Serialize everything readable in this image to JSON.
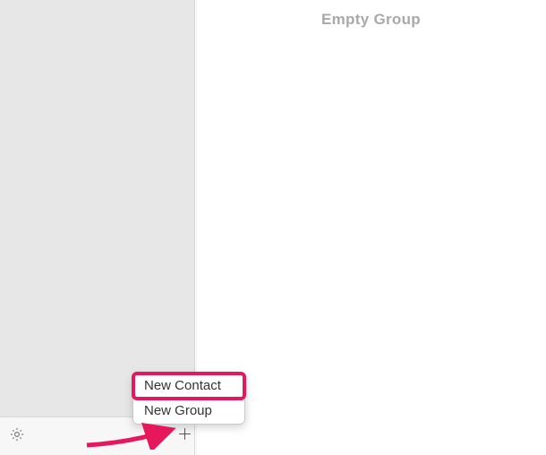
{
  "main": {
    "title": "Empty Group"
  },
  "popup": {
    "new_contact": "New Contact",
    "new_group": "New Group"
  },
  "icons": {
    "gear": "settings-gear",
    "plus": "plus"
  },
  "annotation": {
    "highlight_color": "#e6175a",
    "arrow_color": "#e6175a"
  }
}
